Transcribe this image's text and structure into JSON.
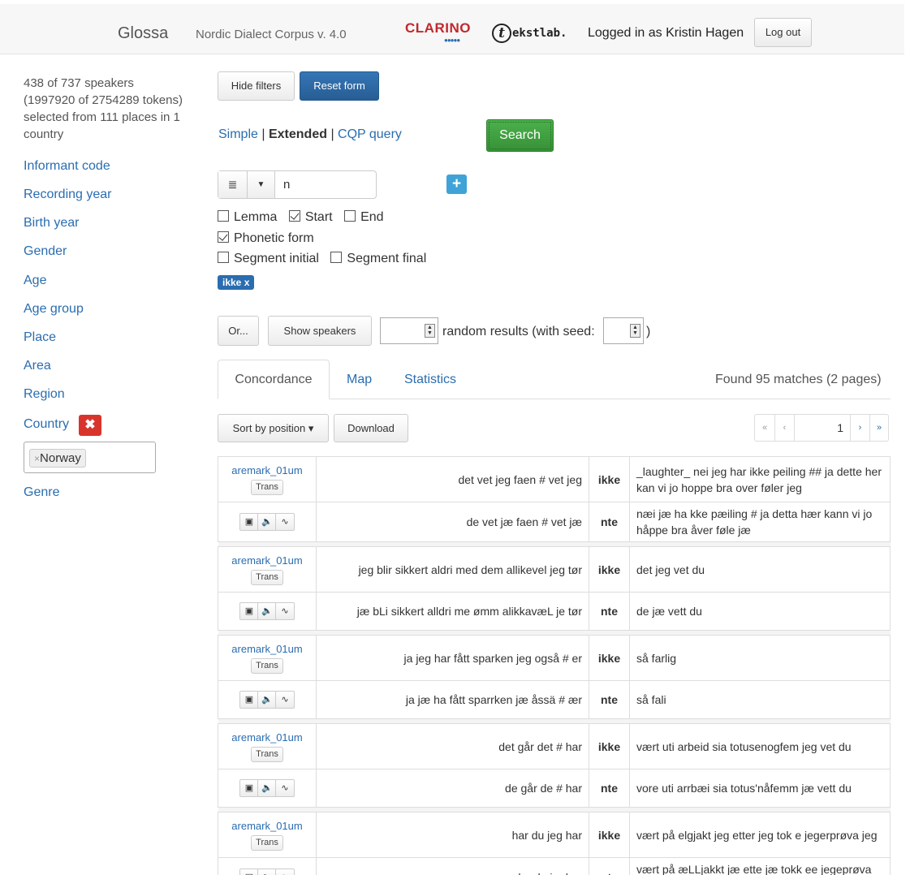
{
  "header": {
    "brand": "Glossa",
    "corpus": "Nordic Dialect Corpus v. 4.0",
    "clarino_logo": "CLARINO",
    "tekstlab_logo": "ekstlab.",
    "tekstlab_circle": "t",
    "logged_in": "Logged in as Kristin Hagen",
    "logout": "Log out"
  },
  "sidebar": {
    "summary": "438 of 737 speakers (1997920 of 2754289 tokens) selected from 111 places in 1 country",
    "filters": [
      "Informant code",
      "Recording year",
      "Birth year",
      "Gender",
      "Age",
      "Age group",
      "Place",
      "Area",
      "Region",
      "Country",
      "Genre"
    ],
    "country_remove": "✖",
    "country_value": "Norway",
    "chip_remove": "×"
  },
  "toolbar": {
    "hide_filters": "Hide filters",
    "reset_form": "Reset form",
    "mode_simple": "Simple",
    "mode_sep": "|",
    "mode_extended": "Extended",
    "mode_cqp": "CQP query",
    "search": "Search"
  },
  "query": {
    "token_value": "n",
    "list_icon": "≣",
    "dropdown_icon": "▼",
    "add": "+",
    "lemma": "Lemma",
    "start": "Start",
    "end": "End",
    "phonetic": "Phonetic form",
    "seg_initial": "Segment initial",
    "seg_final": "Segment final",
    "tag": "ikke x",
    "checked": {
      "lemma": false,
      "start": true,
      "end": false,
      "phonetic": true,
      "seg_initial": false,
      "seg_final": false
    }
  },
  "options": {
    "or": "Or...",
    "show_speakers": "Show speakers",
    "random": "random results (with seed:",
    "close_paren": ")"
  },
  "tabs": {
    "concordance": "Concordance",
    "map": "Map",
    "statistics": "Statistics",
    "found": "Found 95 matches (2 pages)"
  },
  "results_bar": {
    "sort": "Sort by position ▾",
    "download": "Download",
    "first": "«",
    "prev": "‹",
    "page": "1",
    "next": "›",
    "last": "»"
  },
  "results": [
    {
      "speaker": "aremark_01um",
      "trans": "Trans",
      "left": "det vet jeg faen # vet jeg",
      "kw": "ikke",
      "right": "_laughter_ nei jeg har ikke peiling ## ja dette her kan vi jo hoppe bra over føler jeg",
      "pleft": "de vet jæ faen # vet jæ",
      "pkw": "nte",
      "pright": "næi jæ ha kke pæiling # ja detta hær kann vi jo håppe bra åver føle jæ"
    },
    {
      "speaker": "aremark_01um",
      "trans": "Trans",
      "left": "jeg blir sikkert aldri med dem allikevel jeg tør",
      "kw": "ikke",
      "right": "det jeg vet du",
      "pleft": "jæ bLi sikkert alldri me ømm alikkavæL je tør",
      "pkw": "nte",
      "pright": "de jæ vett du"
    },
    {
      "speaker": "aremark_01um",
      "trans": "Trans",
      "left": "ja jeg har fått sparken jeg også # er",
      "kw": "ikke",
      "right": "så farlig",
      "pleft": "ja jæ ha fått sparrken jæ åssä # ær",
      "pkw": "nte",
      "pright": "så fali"
    },
    {
      "speaker": "aremark_01um",
      "trans": "Trans",
      "left": "det går det # har",
      "kw": "ikke",
      "right": "vært uti arbeid sia totusenogfem jeg vet du",
      "pleft": "de går de # har",
      "pkw": "nte",
      "pright": "vore uti arrbæi sia totus'nåfemm jæ vett du"
    },
    {
      "speaker": "aremark_01um",
      "trans": "Trans",
      "left": "har du jeg har",
      "kw": "ikke",
      "right": "vært på elgjakt jeg etter jeg tok e jegerprøva jeg",
      "pleft": "ha du jæ har",
      "pkw": "nte",
      "pright": "vært på æLLjakkt jæ ette jæ tokk ee jegeprøva jæ"
    }
  ],
  "media_icons": {
    "film": "film-icon",
    "audio": "speaker-icon",
    "wave": "waveform-icon"
  }
}
